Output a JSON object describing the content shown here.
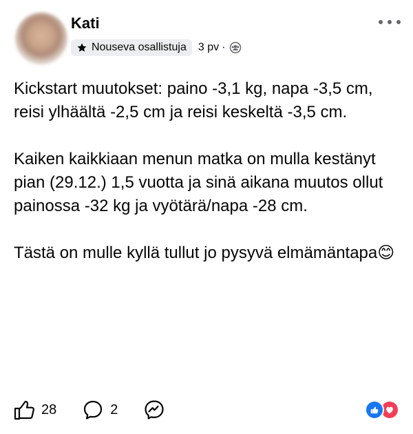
{
  "post": {
    "author": "Kati",
    "badge_label": "Nouseva osallistuja",
    "timestamp": "3 pv",
    "separator": "·",
    "audience_icon": "group-icon",
    "paragraphs": [
      "Kickstart muutokset: paino -3,1 kg, napa -3,5 cm, reisi ylhäältä -2,5 cm ja reisi keskeltä -3,5 cm.",
      "Kaiken kaikkiaan menun matka on mulla kestänyt pian (29.12.) 1,5 vuotta ja sinä aikana muutos ollut painossa -32 kg ja vyötärä/napa -28 cm.",
      "Tästä on mulle kyllä tullut jo pysyvä elmämäntapa😊"
    ]
  },
  "actions": {
    "like_count": "28",
    "comment_count": "2"
  },
  "reactions": [
    "like",
    "love"
  ],
  "colors": {
    "like_blue": "#1877f2",
    "love_red": "#f33e58",
    "badge_bg": "#ebedf0",
    "icon_gray": "#65676b"
  }
}
